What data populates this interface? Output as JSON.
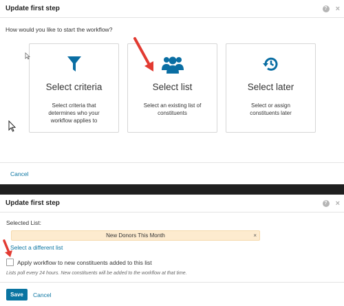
{
  "top_dialog": {
    "title": "Update first step",
    "question": "How would you like to start the workflow?",
    "cards": [
      {
        "title": "Select criteria",
        "description": "Select criteria that determines who your workflow applies to",
        "icon": "filter-icon"
      },
      {
        "title": "Select list",
        "description": "Select an existing list of constituents",
        "icon": "group-icon"
      },
      {
        "title": "Select later",
        "description": "Select or assign constituents later",
        "icon": "history-icon"
      }
    ],
    "cancel": "Cancel"
  },
  "bottom_dialog": {
    "title": "Update first step",
    "selected_list_label": "Selected List:",
    "selected_list_value": "New Donors This Month",
    "remove": "×",
    "change_link": "Select a different list",
    "checkbox_label": "Apply workflow to new constituents added to this list",
    "note": "Lists poll every 24 hours. New constituents will be added to the workflow at that time.",
    "save": "Save",
    "cancel": "Cancel"
  },
  "header_icons": {
    "help": "?",
    "close": "×"
  },
  "colors": {
    "accent": "#0974a1",
    "icon_blue": "#0a6ea3",
    "highlight": "#fdebcf",
    "arrow": "#e23b32"
  }
}
